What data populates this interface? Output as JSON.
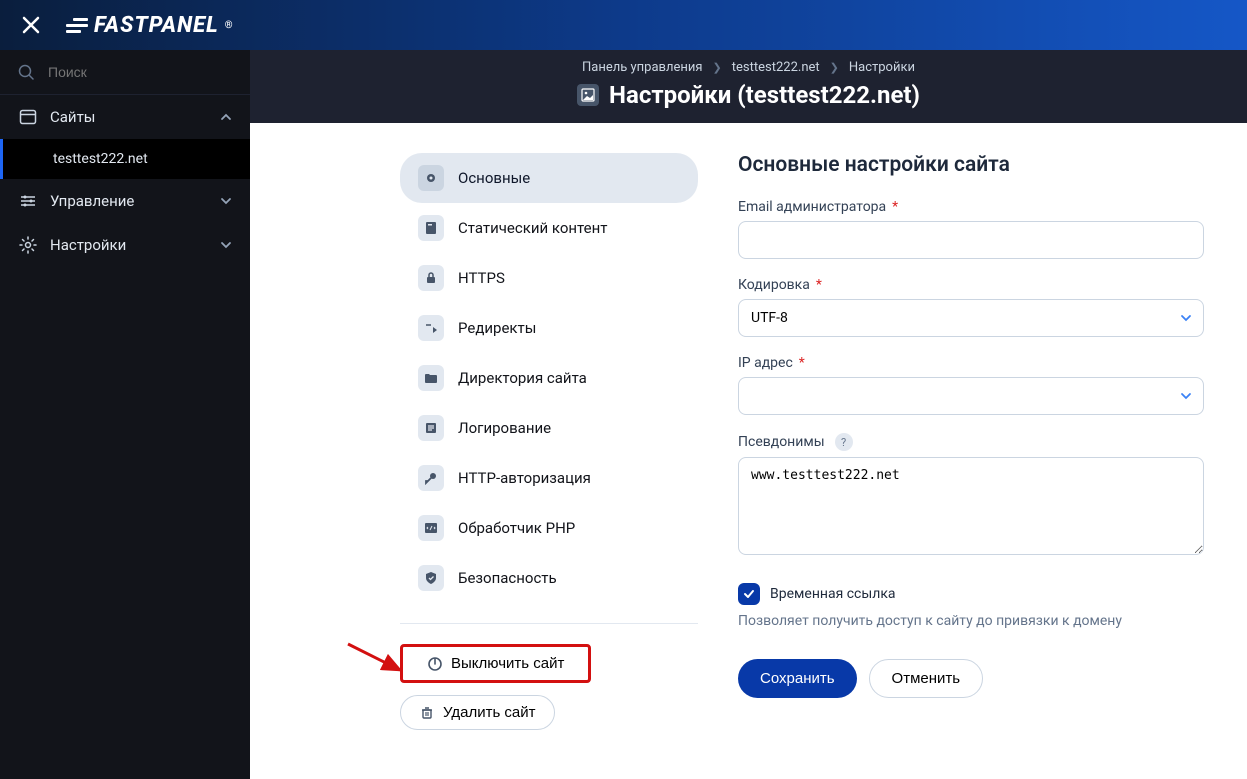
{
  "brand": "FASTPANEL",
  "search": {
    "placeholder": "Поиск"
  },
  "nav": {
    "sites": "Сайты",
    "site_item": "testtest222.net",
    "management": "Управление",
    "settings": "Настройки"
  },
  "breadcrumb": {
    "root": "Панель управления",
    "site": "testtest222.net",
    "leaf": "Настройки"
  },
  "page_title": "Настройки (testtest222.net)",
  "settings_nav": {
    "main": "Основные",
    "static": "Статический контент",
    "https": "HTTPS",
    "redirects": "Редиректы",
    "directory": "Директория сайта",
    "logging": "Логирование",
    "httpauth": "HTTP-авторизация",
    "php": "Обработчик PHP",
    "security": "Безопасность"
  },
  "actions": {
    "disable": "Выключить сайт",
    "delete": "Удалить сайт"
  },
  "form": {
    "title": "Основные настройки сайта",
    "email_label": "Email администратора",
    "email_value": "",
    "encoding_label": "Кодировка",
    "encoding_value": "UTF-8",
    "ip_label": "IP адрес",
    "ip_value": "",
    "aliases_label": "Псевдонимы",
    "aliases_value": "www.testtest222.net",
    "templink_label": "Временная ссылка",
    "templink_hint": "Позволяет получить доступ к сайту до привязки к домену",
    "save": "Сохранить",
    "cancel": "Отменить"
  }
}
